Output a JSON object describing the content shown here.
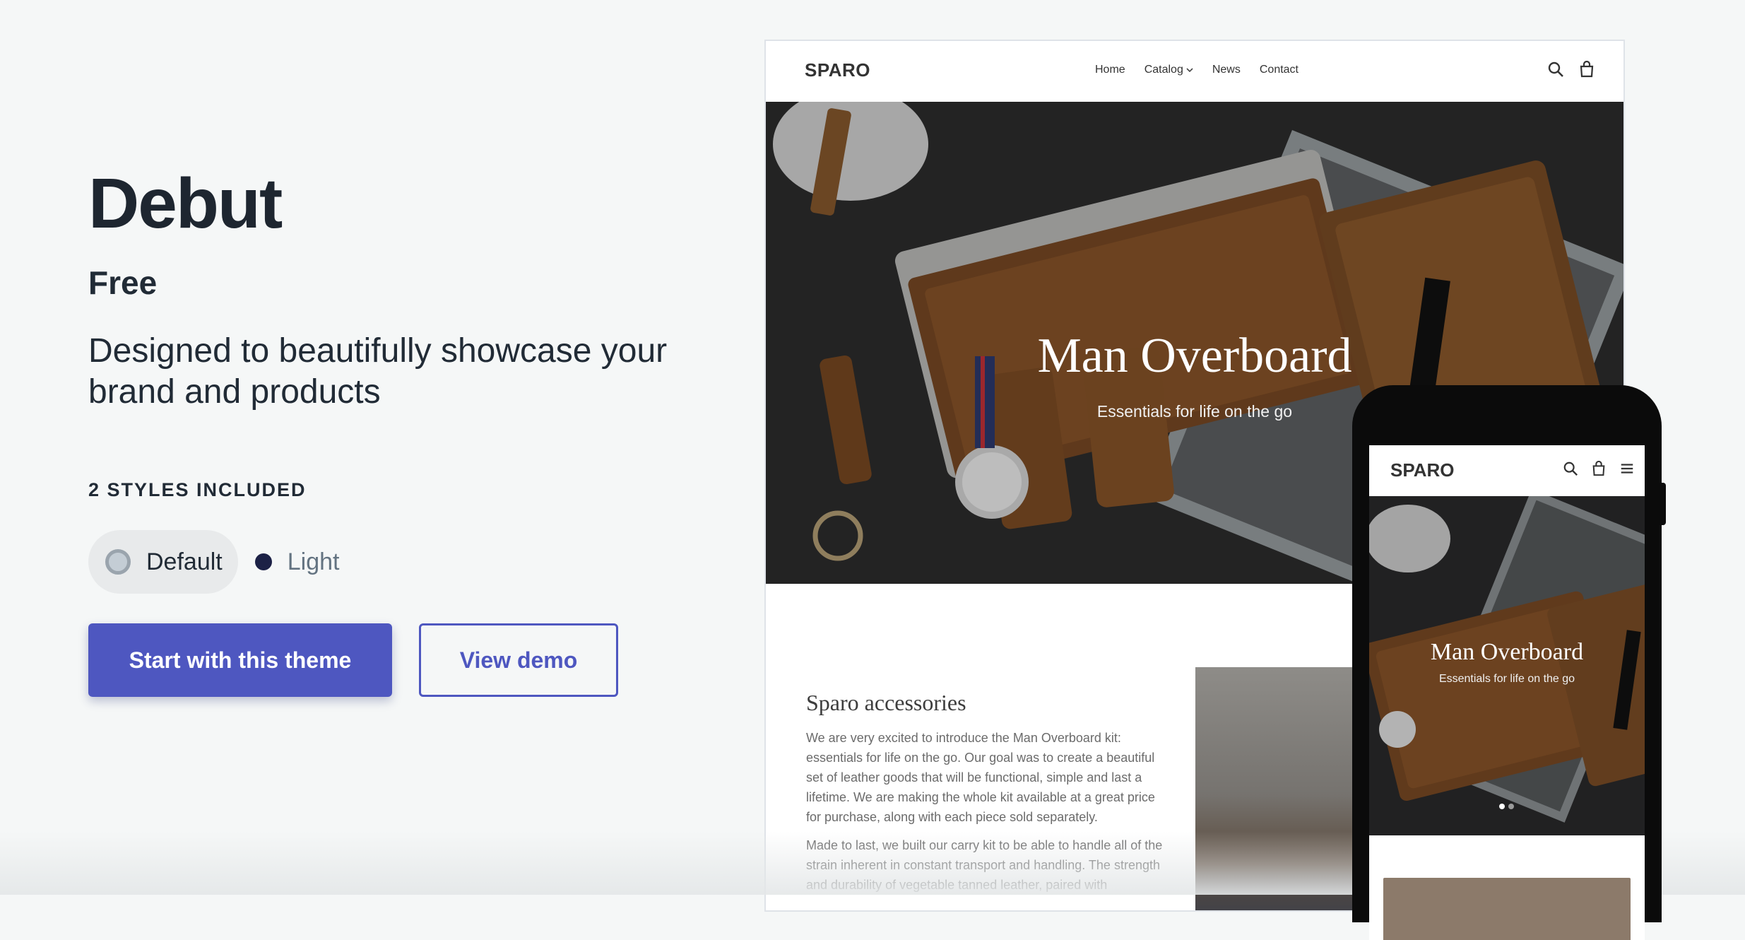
{
  "theme": {
    "title": "Debut",
    "price": "Free",
    "description": "Designed to beautifully showcase your brand and products"
  },
  "styles": {
    "heading": "2 STYLES INCLUDED",
    "options": [
      {
        "label": "Default",
        "selected": true,
        "swatch_color": "#c4cdd5"
      },
      {
        "label": "Light",
        "selected": false,
        "swatch_color": "#1c2146"
      }
    ]
  },
  "actions": {
    "primary_label": "Start with this theme",
    "secondary_label": "View demo",
    "accent_color": "#4e57c0"
  },
  "desktop_preview": {
    "logo": "SPARO",
    "nav": [
      "Home",
      "Catalog",
      "News",
      "Contact"
    ],
    "icons": [
      "search-icon",
      "cart-icon"
    ],
    "hero_title": "Man Overboard",
    "hero_subtitle": "Essentials for life on the go",
    "slide_count": 2,
    "active_slide": 1,
    "section_title": "Sparo accessories",
    "paragraphs": [
      "We are very excited to introduce the Man Overboard kit: essentials for life on the go. Our goal was to create a beautiful set of leather goods that will be functional, simple and last a lifetime. We are making the whole kit available at a great price for purchase, along with each piece sold separately.",
      "Made to last, we built our carry kit to be able to handle all of the strain inherent in constant transport and handling. The strength and durability of vegetable tanned leather, paired with"
    ]
  },
  "mobile_preview": {
    "logo": "SPARO",
    "icons": [
      "search-icon",
      "cart-icon",
      "menu-icon"
    ],
    "hero_title": "Man Overboard",
    "hero_subtitle": "Essentials for life on the go",
    "slide_count": 2,
    "active_slide": 1
  }
}
